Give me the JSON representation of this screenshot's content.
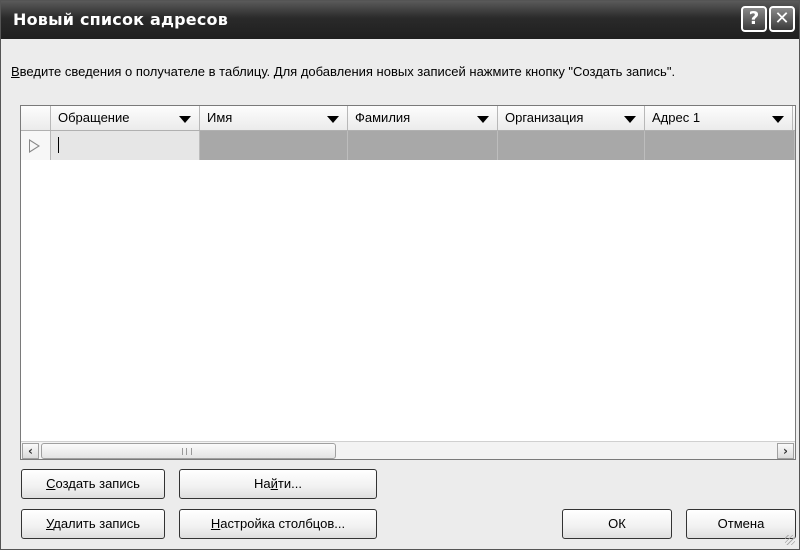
{
  "window": {
    "title": "Новый список адресов",
    "help_icon": "?",
    "close_icon": "✕"
  },
  "instruction": {
    "first_char": "В",
    "rest": "ведите сведения о получателе в таблицу. Для добавления новых записей нажмите кнопку \"Создать запись\"."
  },
  "grid": {
    "columns": [
      {
        "label": "Обращение"
      },
      {
        "label": "Имя"
      },
      {
        "label": "Фамилия"
      },
      {
        "label": "Организация"
      },
      {
        "label": "Адрес 1"
      }
    ],
    "scroll_left": "‹",
    "scroll_right": "›"
  },
  "buttons": {
    "new_entry": {
      "u": "С",
      "rest": "оздать запись"
    },
    "find": {
      "a": "На",
      "u": "й",
      "b": "ти..."
    },
    "delete_entry": {
      "u": "У",
      "rest": "далить запись"
    },
    "customize_columns": {
      "u": "Н",
      "rest": "астройка столбцов..."
    },
    "ok": "ОК",
    "cancel": "Отмена"
  }
}
